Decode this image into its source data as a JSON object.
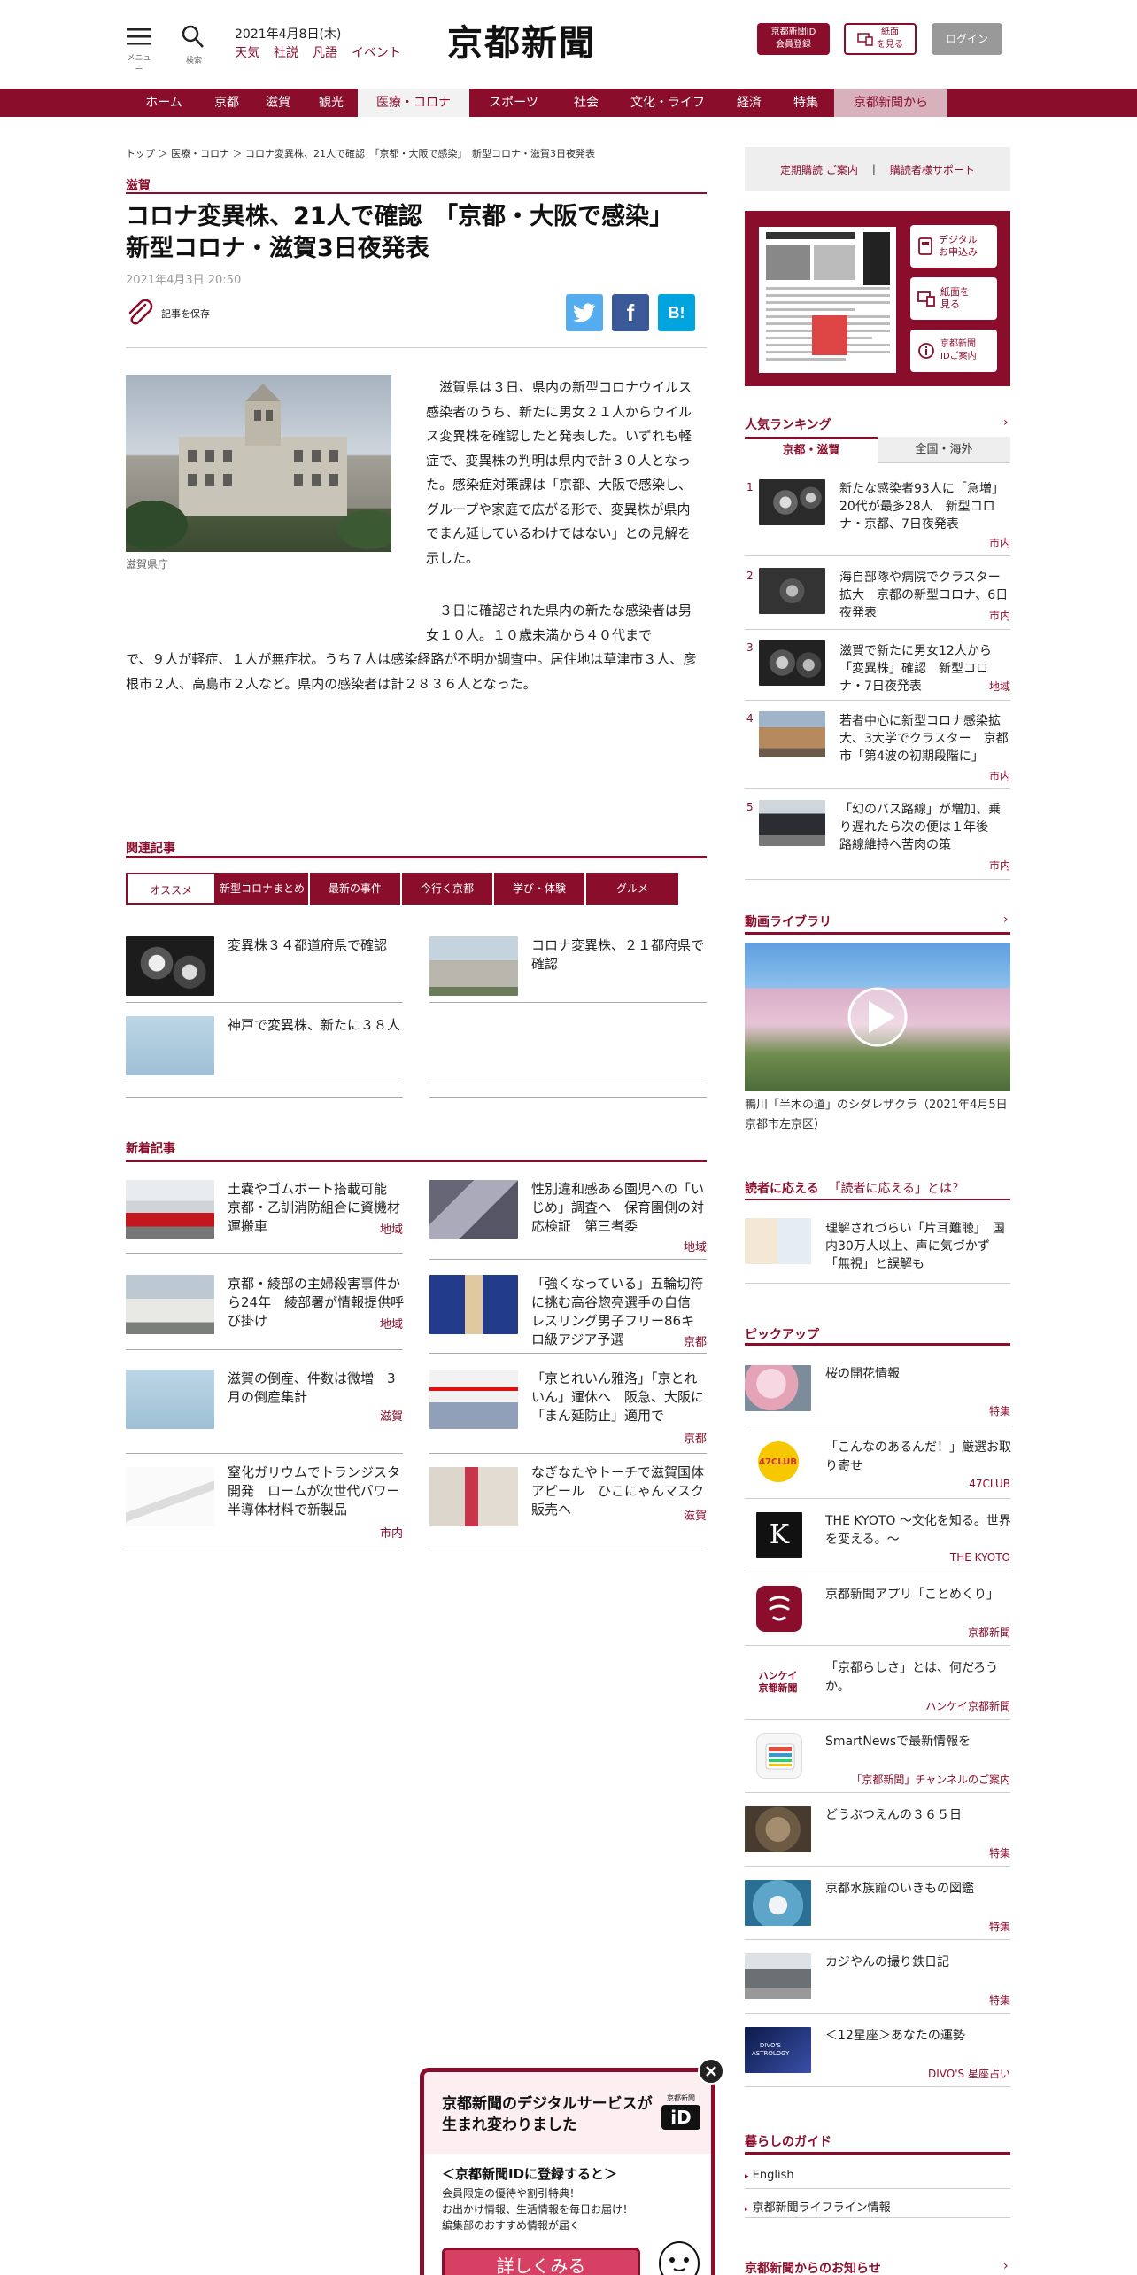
{
  "header": {
    "menu_label": "メニュー",
    "search_label": "検索",
    "date": "2021年4月8日(木)",
    "links": [
      "天気",
      "社説",
      "凡語",
      "イベント"
    ],
    "logo": "京都新聞",
    "id_button": "京都新聞ID\n会員登録",
    "paper_button": "紙面\nを見る",
    "login": "ログイン"
  },
  "gnav": [
    "ホーム",
    "京都",
    "滋賀",
    "観光",
    "医療・コロナ",
    "スポーツ",
    "社会",
    "文化・ライフ",
    "経済",
    "特集",
    "京都新聞から"
  ],
  "breadcrumb": [
    "トップ",
    "医療・コロナ",
    "コロナ変異株、21人で確認　「京都・大阪で感染」　新型コロナ・滋賀3日夜発表"
  ],
  "article": {
    "category": "滋賀",
    "title": "コロナ変異株、21人で確認　「京都・大阪で感染」　新型コロナ・滋賀3日夜発表",
    "date": "2021年4月3日 20:50",
    "save": "記事を保存",
    "caption": "滋賀県庁",
    "body1": "　滋賀県は３日、県内の新型コロナウイルス感染者のうち、新たに男女２１人からウイルス変異株を確認したと発表した。いずれも軽症で、変異株の判明は県内で計３０人となった。感染症対策課は「京都、大阪で感染し、グループや家庭で広がる形で、変異株が県内でまん延しているわけではない」との見解を示した。",
    "body2a": "　３日に確認された県内の新たな感染者は男女１０人。１０歳未満から４０代まで",
    "body2b": "で、９人が軽症、１人が無症状。うち７人は感染経路が不明か調査中。居住地は草津市３人、彦根市２人、高島市２人など。県内の感染者は計２８３６人となった。"
  },
  "share": {
    "twitter": "twitter",
    "facebook": "f",
    "hatena": "B!"
  },
  "related": {
    "heading": "関連記事",
    "tabs": [
      "オススメ",
      "新型コロナまとめ",
      "最新の事件",
      "今行く京都",
      "学び・体験",
      "グルメ"
    ],
    "items": [
      {
        "title": "変異株３４都道府県で確認"
      },
      {
        "title": "コロナ変異株、２１都府県で確認"
      },
      {
        "title": "神戸で変異株、新たに３８人"
      }
    ]
  },
  "latest": {
    "heading": "新着記事",
    "items": [
      {
        "title": "土嚢やゴムボート搭載可能　京都・乙訓消防組合に資機材運搬車",
        "tag": "地域"
      },
      {
        "title": "性別違和感ある園児への「いじめ」調査へ　保育園側の対応検証　第三者委",
        "tag": "地域"
      },
      {
        "title": "京都・綾部の主婦殺害事件から24年　綾部署が情報提供呼び掛け",
        "tag": "地域"
      },
      {
        "title": "「強くなっている」五輪切符に挑む高谷惣亮選手の自信　レスリング男子フリー86キロ級アジア予選",
        "tag": "京都"
      },
      {
        "title": "滋賀の倒産、件数は微増　3月の倒産集計",
        "tag": "滋賀"
      },
      {
        "title": "「京とれいん雅洛」「京とれいん」運休へ　阪急、大阪に「まん延防止」適用で",
        "tag": "京都"
      },
      {
        "title": "窒化ガリウムでトランジスタ開発　ロームが次世代パワー半導体材料で新製品",
        "tag": "市内"
      },
      {
        "title": "なぎなたやトーチで滋賀国体アピール　ひこにゃんマスク販売へ",
        "tag": "滋賀"
      }
    ]
  },
  "sidebar": {
    "sub_links": [
      "定期購読 ご案内",
      "購読者様サポート"
    ],
    "paper_buttons": [
      "デジタル\nお申込み",
      "紙面を\n見る",
      "京都新聞\nIDご案内"
    ],
    "ranking_heading": "人気ランキング",
    "ranking_tabs": [
      "京都・滋賀",
      "全国・海外"
    ],
    "ranking": [
      {
        "n": "1",
        "title": "新たな感染者93人に「急増」20代が最多28人　新型コロナ・京都、7日夜発表",
        "tag": "市内"
      },
      {
        "n": "2",
        "title": "海自部隊や病院でクラスター拡大　京都の新型コロナ、6日夜発表",
        "tag": "市内"
      },
      {
        "n": "3",
        "title": "滋賀で新たに男女12人から「変異株」確認　新型コロナ・7日夜発表",
        "tag": "地域"
      },
      {
        "n": "4",
        "title": "若者中心に新型コロナ感染拡大、3大学でクラスター　京都市「第4波の初期段階に」",
        "tag": "市内"
      },
      {
        "n": "5",
        "title": "「幻のバス路線」が増加、乗り遅れたら次の便は１年後　路線維持へ苦肉の策",
        "tag": "市内"
      }
    ],
    "video_heading": "動画ライブラリ",
    "video_caption": "鴨川「半木の道」のシダレザクラ（2021年4月5日　京都市左京区）",
    "reader_label": "読者に応える",
    "reader_sub": "「読者に応える」とは？",
    "reader_item": "理解されづらい「片耳難聴」　国内30万人以上、声に気づかず「無視」と誤解も",
    "pickup_heading": "ピックアップ",
    "pickup": [
      {
        "title": "桜の開花情報",
        "tag": "特集"
      },
      {
        "title": "「こんなのあるんだ！」厳選お取り寄せ",
        "tag": "47CLUB"
      },
      {
        "title": "THE KYOTO ～文化を知る。世界を変える。～",
        "tag": "THE KYOTO"
      },
      {
        "title": "京都新聞アプリ「ことめくり」",
        "tag": "京都新聞"
      },
      {
        "title": "「京都らしさ」とは、何だろうか。",
        "tag": "ハンケイ京都新聞"
      },
      {
        "title": "SmartNewsで最新情報を",
        "tag": "「京都新聞」チャンネルのご案内"
      },
      {
        "title": "どうぶつえんの３６５日",
        "tag": "特集"
      },
      {
        "title": "京都水族館のいきもの図鑑",
        "tag": "特集"
      },
      {
        "title": "カジやんの撮り鉄日記",
        "tag": "特集"
      },
      {
        "title": "＜12星座＞あなたの運勢",
        "tag": "DIVO'S 星座占い"
      }
    ],
    "pickup_logo_text": {
      "club": "47CLUB",
      "k": "K",
      "hankei": "ハンケイ\n京都新聞",
      "divos": "DIVO'S\nASTROLOGY"
    },
    "guide_heading": "暮らしのガイド",
    "guide": [
      "English",
      "京都新聞ライフライン情報"
    ],
    "notice_heading": "京都新聞からのお知らせ"
  },
  "popup": {
    "title": "京都新聞のデジタルサービスが生まれ変わりました",
    "id_badge": "京都新聞",
    "id_mark": "iD",
    "sub": "＜京都新聞IDに登録すると＞",
    "lines": [
      "会員限定の優待や割引特典！",
      "お出かけ情報、生活情報を毎日お届け！",
      "編集部のおすすめ情報が届く"
    ],
    "cta": "詳しくみる"
  }
}
